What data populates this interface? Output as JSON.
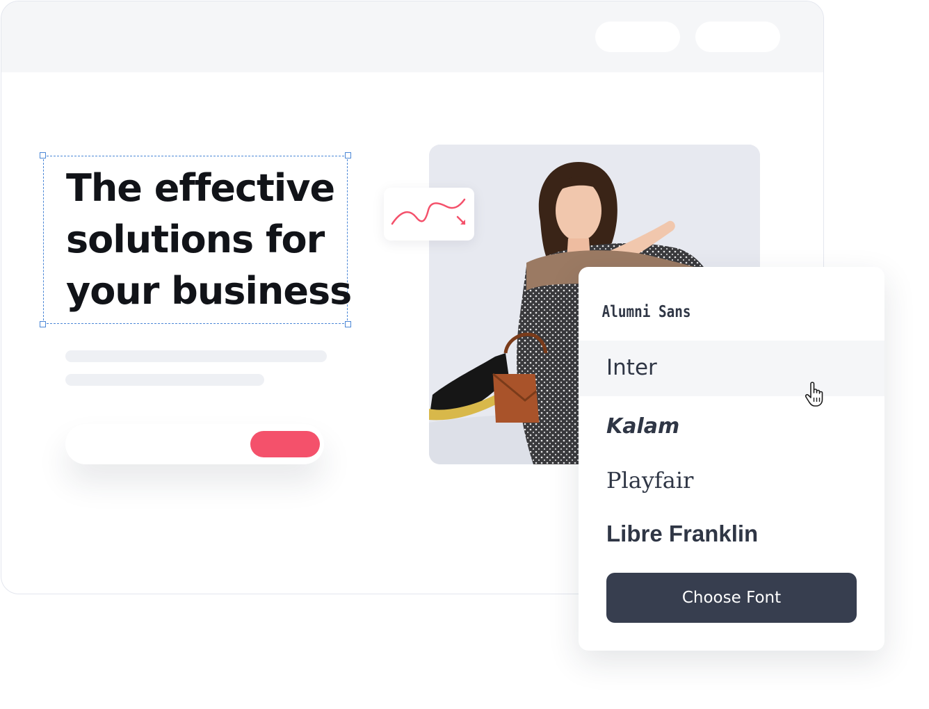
{
  "hero": {
    "headline_lines": [
      "The effective",
      "solutions for",
      "your business"
    ]
  },
  "font_menu": {
    "options": [
      "Alumni Sans",
      "Inter",
      "Kalam",
      "Playfair",
      "Libre Franklin"
    ],
    "hovered_option": "Inter",
    "choose_label": "Choose Font"
  },
  "colors": {
    "accent": "#f4516b",
    "button_dark": "#373e4f",
    "selection": "#4a86d6"
  }
}
